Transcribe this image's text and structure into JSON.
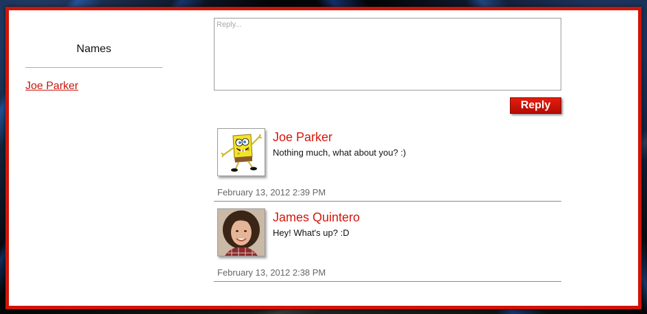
{
  "sidebar": {
    "title": "Names",
    "names": [
      {
        "label": "Joe Parker"
      }
    ]
  },
  "reply": {
    "placeholder": "Reply...",
    "value": "",
    "button_label": "Reply"
  },
  "comments": [
    {
      "author": "Joe Parker",
      "message": "Nothing much, what about you? :)",
      "timestamp": "February 13, 2012 2:39 PM",
      "avatar_icon": "cartoon-sponge-avatar"
    },
    {
      "author": "James Quintero",
      "message": "Hey! What's up? :D",
      "timestamp": "February 13, 2012 2:38 PM",
      "avatar_icon": "person-photo-avatar"
    }
  ],
  "colors": {
    "accent": "#d11406",
    "link": "#c5170a"
  }
}
